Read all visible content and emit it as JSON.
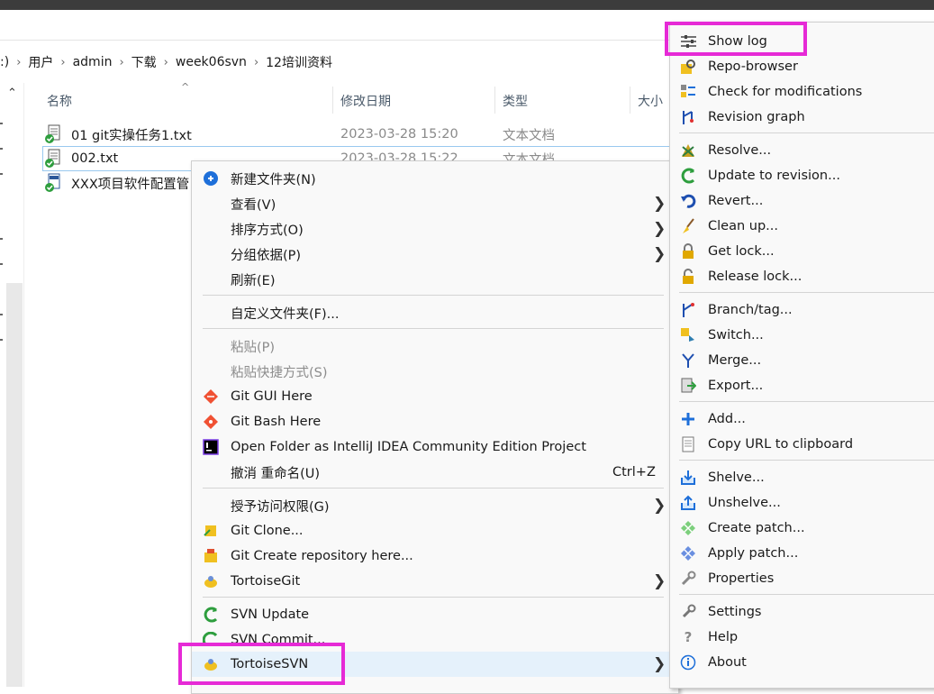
{
  "breadcrumb": {
    "drive": ":)",
    "items": [
      "用户",
      "admin",
      "下载",
      "week06svn",
      "12培训资料"
    ]
  },
  "columns": {
    "name": "名称",
    "modified": "修改日期",
    "type": "类型",
    "size": "大小"
  },
  "files": [
    {
      "name": "01 git实操任务1.txt",
      "date": "2023-03-28 15:20",
      "type": "文本文档"
    },
    {
      "name": "002.txt",
      "date": "2023-03-28 15:22",
      "type": "文本文档"
    },
    {
      "name": "XXX项目软件配置管",
      "date": "",
      "type": ""
    }
  ],
  "context_menu": {
    "new_folder": "新建文件夹(N)",
    "view": "查看(V)",
    "sort": "排序方式(O)",
    "group": "分组依据(P)",
    "refresh": "刷新(E)",
    "customize": "自定义文件夹(F)...",
    "paste": "粘贴(P)",
    "paste_shortcut": "粘贴快捷方式(S)",
    "git_gui": "Git GUI Here",
    "git_bash": "Git Bash Here",
    "intellij": "Open Folder as IntelliJ IDEA Community Edition Project",
    "undo_rename": "撤消 重命名(U)",
    "undo_shortcut": "Ctrl+Z",
    "grant_access": "授予访问权限(G)",
    "git_clone": "Git Clone...",
    "git_create": "Git Create repository here...",
    "tortoisegit": "TortoiseGit",
    "svn_update": "SVN Update",
    "svn_commit": "SVN Commit...",
    "tortoisesvn": "TortoiseSVN",
    "arrow": "❯"
  },
  "svn_menu": {
    "show_log": "Show log",
    "repo_browser": "Repo-browser",
    "check_mods": "Check for modifications",
    "revision_graph": "Revision graph",
    "resolve": "Resolve...",
    "update_to_rev": "Update to revision...",
    "revert": "Revert...",
    "clean_up": "Clean up...",
    "get_lock": "Get lock...",
    "release_lock": "Release lock...",
    "branch_tag": "Branch/tag...",
    "switch": "Switch...",
    "merge": "Merge...",
    "export": "Export...",
    "add": "Add...",
    "copy_url": "Copy URL to clipboard",
    "shelve": "Shelve...",
    "unshelve": "Unshelve...",
    "create_patch": "Create patch...",
    "apply_patch": "Apply patch...",
    "properties": "Properties",
    "settings": "Settings",
    "help": "Help",
    "about": "About"
  },
  "highlight_color": "#e62ad6"
}
